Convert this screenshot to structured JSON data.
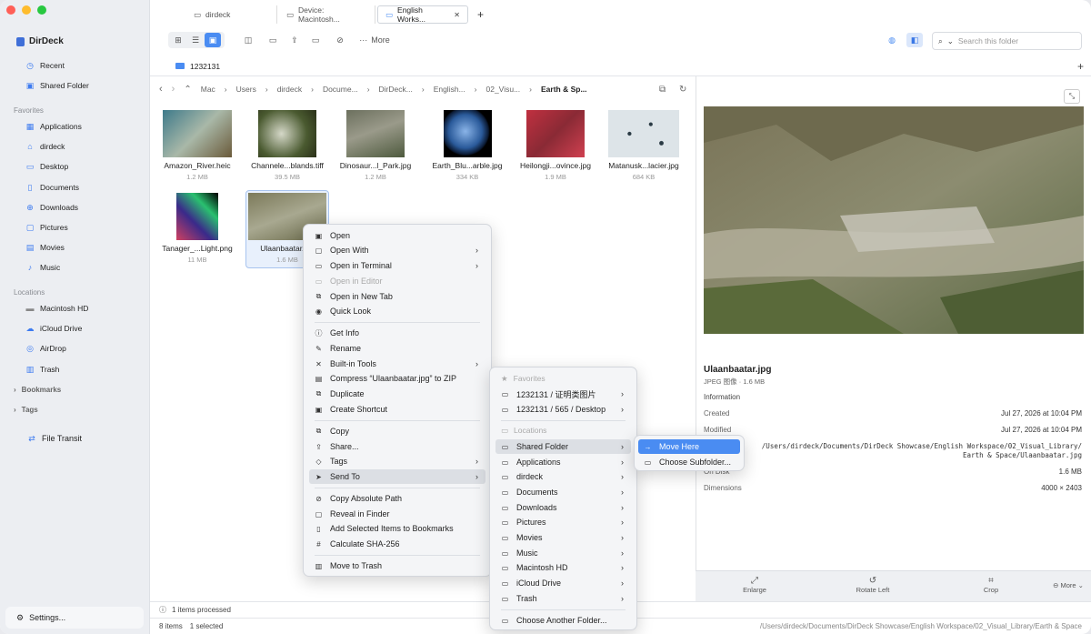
{
  "sidebar": {
    "app_name": "DirDeck",
    "top": [
      {
        "label": "Recent",
        "icon": "clock-icon"
      },
      {
        "label": "Shared Folder",
        "icon": "shared-folder-icon"
      }
    ],
    "favorites_heading": "Favorites",
    "favorites": [
      "Applications",
      "dirdeck",
      "Desktop",
      "Documents",
      "Downloads",
      "Pictures",
      "Movies",
      "Music"
    ],
    "locations_heading": "Locations",
    "locations": [
      "Macintosh HD",
      "iCloud Drive",
      "AirDrop",
      "Trash"
    ],
    "bookmarks": "Bookmarks",
    "tags": "Tags",
    "file_transit": "File Transit",
    "settings": "Settings..."
  },
  "tabs": [
    {
      "label": "dirdeck"
    },
    {
      "label": "Device: Macintosh..."
    },
    {
      "label": "English Works..."
    }
  ],
  "toolbar": {
    "more": "More",
    "search_placeholder": "Search this folder"
  },
  "location_folder": "1232131",
  "breadcrumb": [
    "Mac",
    "Users",
    "dirdeck",
    "Docume...",
    "DirDeck...",
    "English...",
    "02_Visu...",
    "Earth & Sp..."
  ],
  "files": [
    {
      "name": "Amazon_River.heic",
      "size": "1.2 MB",
      "color": "#8fa6a2"
    },
    {
      "name": "Channele...blands.tiff",
      "size": "39.5 MB",
      "color": "#5c6b3a"
    },
    {
      "name": "Dinosaur...l_Park.jpg",
      "size": "1.2 MB",
      "color": "#7a7c6a"
    },
    {
      "name": "Earth_Blu...arble.jpg",
      "size": "334 KB",
      "color": "#2a5a9a"
    },
    {
      "name": "Heilongji...ovince.jpg",
      "size": "1.9 MB",
      "color": "#a8323a"
    },
    {
      "name": "Matanusk...lacier.jpg",
      "size": "684 KB",
      "color": "#cdd6da"
    },
    {
      "name": "Tanager_...Light.png",
      "size": "11 MB",
      "color": "#4a2a6a"
    },
    {
      "name": "Ulaanbaatar.jpg",
      "size": "1.6 MB",
      "color": "#8a8a6a"
    }
  ],
  "preview": {
    "filename": "Ulaanbaatar.jpg",
    "subtitle": "JPEG 图像 · 1.6 MB",
    "info_heading": "Information",
    "created_label": "Created",
    "created": "Jul 27, 2026 at 10:04 PM",
    "modified_label": "Modified",
    "modified": "Jul 27, 2026 at 10:04 PM",
    "path": "/Users/dirdeck/Documents/DirDeck Showcase/English Workspace/02_Visual_Library/ Earth & Space/Ulaanbaatar.jpg",
    "ondisk_label": "On Disk",
    "ondisk": "1.6 MB",
    "dimensions_label": "Dimensions",
    "dimensions": "4000 × 2403",
    "buttons": [
      "Enlarge",
      "Rotate Left",
      "Crop",
      "More"
    ]
  },
  "context_menu": {
    "group1": [
      {
        "label": "Open",
        "icon": "open-icon",
        "submenu": false,
        "disabled": false
      },
      {
        "label": "Open With",
        "icon": "open-with-icon",
        "submenu": true,
        "disabled": false
      },
      {
        "label": "Open in Terminal",
        "icon": "terminal-icon",
        "submenu": true,
        "disabled": false
      },
      {
        "label": "Open in Editor",
        "icon": "editor-icon",
        "submenu": false,
        "disabled": true
      },
      {
        "label": "Open in New Tab",
        "icon": "new-tab-icon",
        "submenu": false,
        "disabled": false
      },
      {
        "label": "Quick Look",
        "icon": "eye-icon",
        "submenu": false,
        "disabled": false
      }
    ],
    "group2": [
      {
        "label": "Get Info",
        "icon": "info-icon",
        "submenu": false
      },
      {
        "label": "Rename",
        "icon": "pencil-icon",
        "submenu": false
      },
      {
        "label": "Built-in Tools",
        "icon": "tools-icon",
        "submenu": true
      },
      {
        "label": "Compress “Ulaanbaatar.jpg” to ZIP",
        "icon": "zip-icon",
        "submenu": false
      },
      {
        "label": "Duplicate",
        "icon": "duplicate-icon",
        "submenu": false
      },
      {
        "label": "Create Shortcut",
        "icon": "shortcut-icon",
        "submenu": false
      }
    ],
    "group3": [
      {
        "label": "Copy",
        "icon": "copy-icon",
        "submenu": false
      },
      {
        "label": "Share...",
        "icon": "share-icon",
        "submenu": false
      },
      {
        "label": "Tags",
        "icon": "tag-icon",
        "submenu": true
      },
      {
        "label": "Send To",
        "icon": "send-icon",
        "submenu": true
      }
    ],
    "group4": [
      {
        "label": "Copy Absolute Path",
        "icon": "link-icon"
      },
      {
        "label": "Reveal in Finder",
        "icon": "finder-icon"
      },
      {
        "label": "Add Selected Items to Bookmarks",
        "icon": "bookmark-icon"
      },
      {
        "label": "Calculate SHA-256",
        "icon": "hash-icon"
      }
    ],
    "group5": [
      {
        "label": "Move to Trash",
        "icon": "trash-icon"
      }
    ]
  },
  "send_to_menu": {
    "favorites_heading": "Favorites",
    "favorites": [
      "1232131 / 证明类图片",
      "1232131 / 565 / Desktop"
    ],
    "locations_heading": "Locations",
    "locations": [
      "Shared Folder",
      "Applications",
      "dirdeck",
      "Documents",
      "Downloads",
      "Pictures",
      "Movies",
      "Music",
      "Macintosh HD",
      "iCloud Drive",
      "Trash"
    ],
    "other": "Choose Another Folder..."
  },
  "shared_folder_menu": {
    "move_here": "Move Here",
    "choose_subfolder": "Choose Subfolder..."
  },
  "status": {
    "processed": "1 items processed",
    "items": "8 items",
    "selected": "1 selected",
    "path": "/Users/dirdeck/Documents/DirDeck Showcase/English Workspace/02_Visual_Library/Earth & Space"
  }
}
